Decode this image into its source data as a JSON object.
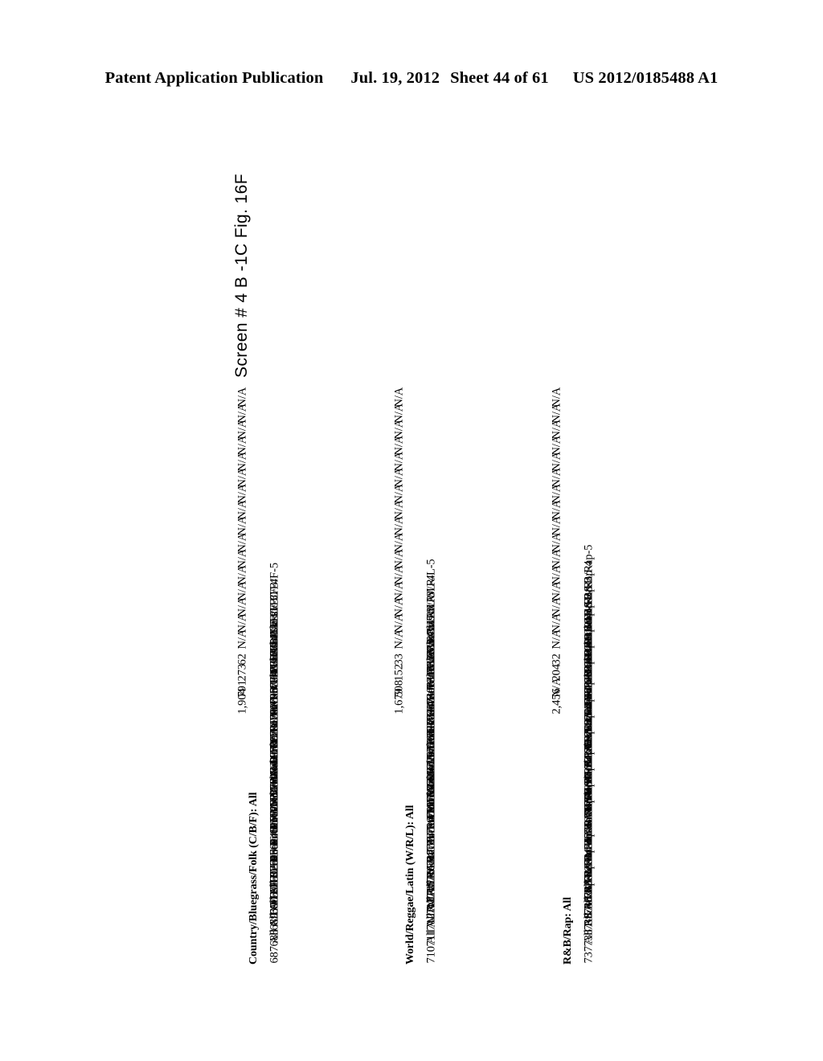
{
  "header": {
    "publication": "Patent Application Publication",
    "date": "Jul. 19, 2012",
    "sheet": "Sheet 44 of 61",
    "patent_number": "US 2012/0185488 A1"
  },
  "figure": {
    "caption": "Screen # 4 B -1C  Fig. 16F"
  },
  "table": {
    "columns": [
      {
        "header": "Country/Bluegrass/Folk (C/B/F): All",
        "rows": [
          {
            "id": "687",
            "label": "All C/B/F-2",
            "value": "1,904"
          },
          {
            "id": "688",
            "label": "All C/B/F-3",
            "value": "791"
          },
          {
            "id": "689",
            "label": "All C/B/F-4",
            "value": "273"
          },
          {
            "id": "690",
            "label": "All C/B/F-5",
            "value": "62"
          },
          {
            "id": "691",
            "label": "Recent C/B/F-2",
            "value": "N/A"
          },
          {
            "id": "692",
            "label": "Recent C/B/F-3",
            "value": "N/A"
          },
          {
            "id": "693",
            "label": "Recent C/B/F-4",
            "value": "N/A"
          },
          {
            "id": "694",
            "label": "Recent C/B/F-5",
            "value": "N/A"
          },
          {
            "id": "695",
            "label": "Modern C/B/F-2",
            "value": "N/A"
          },
          {
            "id": "696",
            "label": "Modern C/B/F-3",
            "value": "N/A"
          },
          {
            "id": "697",
            "label": "Modern C/B/F-4",
            "value": "N/A"
          },
          {
            "id": "698",
            "label": "Modern C/B/F-5",
            "value": "N/A"
          },
          {
            "id": "699",
            "label": "Recent + C/B/F-2",
            "value": "N/A"
          },
          {
            "id": "700",
            "label": "Recent + C/B/F-3",
            "value": "N/A"
          },
          {
            "id": "701",
            "label": "Recent + C/B/F-4",
            "value": "N/A"
          },
          {
            "id": "702",
            "label": "Recent + C/B/F-5",
            "value": "N/A"
          },
          {
            "id": "703",
            "label": "Classic C/B/F-2",
            "value": "N/A"
          },
          {
            "id": "704",
            "label": "Classic C/B/F-3",
            "value": "N/A"
          },
          {
            "id": "705",
            "label": "Classic C/B/F-4",
            "value": "N/A"
          },
          {
            "id": "706",
            "label": "Classic C/B/F-5",
            "value": "N/A"
          }
        ]
      },
      {
        "header": "World/Reggae/Latin (W/R/L): All",
        "rows": [
          {
            "id": "710",
            "label": "All W/R/L-2",
            "value": "1,679"
          },
          {
            "id": "711",
            "label": "All W/R/L-3",
            "value": "508"
          },
          {
            "id": "712",
            "label": "All W/R/L-4",
            "value": "152"
          },
          {
            "id": "713",
            "label": "All W/R/L-5",
            "value": "33"
          },
          {
            "id": "715",
            "label": "Recent W/R/L-2",
            "value": "N/A"
          },
          {
            "id": "716",
            "label": "Recent W/R/L-3",
            "value": "N/A"
          },
          {
            "id": "717",
            "label": "Recent W/R/L-4",
            "value": "N/A"
          },
          {
            "id": "718",
            "label": "Recent W/R/L-5",
            "value": "N/A"
          },
          {
            "id": "720",
            "label": "Modern W/R/L-2",
            "value": "N/A"
          },
          {
            "id": "721",
            "label": "Modern W/R/L-3",
            "value": "N/A"
          },
          {
            "id": "722",
            "label": "Modern W/R/L-4",
            "value": "N/A"
          },
          {
            "id": "723",
            "label": "Modern W/R/L-5",
            "value": "N/A"
          },
          {
            "id": "725",
            "label": "Recent + W/R/L-2",
            "value": "N/A"
          },
          {
            "id": "726",
            "label": "Recent + W/R/L-3",
            "value": "N/A"
          },
          {
            "id": "727",
            "label": "Recent + W/R/L-4",
            "value": "N/A"
          },
          {
            "id": "728",
            "label": "Recent + W/R/L-5",
            "value": "N/A"
          },
          {
            "id": "730",
            "label": "Classic W/R/L-2",
            "value": "N/A"
          },
          {
            "id": "731",
            "label": "Classic W/R/L-3",
            "value": "N/A"
          },
          {
            "id": "732",
            "label": "Classic W/R/L-4",
            "value": "N/A"
          },
          {
            "id": "733",
            "label": "Classic W/R/L-5",
            "value": "N/A"
          }
        ]
      },
      {
        "header": "R&B/Rap: All",
        "rows": [
          {
            "id": "737",
            "label": "All R&B/Rap-2",
            "value": "2,456"
          },
          {
            "id": "738",
            "label": "All R&B/Rap-3",
            "value": "N/A"
          },
          {
            "id": "739",
            "label": "All R&B/Rap-4",
            "value": "204"
          },
          {
            "id": "740",
            "label": "All R&B/Rap-5",
            "value": "32"
          },
          {
            "id": "742",
            "label": "Recent R&B/Rap-2",
            "value": "N/A"
          },
          {
            "id": "743",
            "label": "Recent R&B/Rap-3",
            "value": "N/A"
          },
          {
            "id": "744",
            "label": "Recent R&B/Rap-4",
            "value": "N/A"
          },
          {
            "id": "745",
            "label": "Recent R&B/Rap-5",
            "value": "N/A"
          },
          {
            "id": "746",
            "label": "Modern R&B/Rap-2",
            "value": "N/A"
          },
          {
            "id": "747",
            "label": "Modern R&B/Rap-3",
            "value": "N/A"
          },
          {
            "id": "748",
            "label": "Modern R&B/Rap-4",
            "value": "N/A"
          },
          {
            "id": "749",
            "label": "Modern R&B/Rap-5",
            "value": "N/A"
          },
          {
            "id": "751",
            "label": "Recent + R&B/Rap-2",
            "value": "N/A"
          },
          {
            "id": "752",
            "label": "Recent + R&B/Rap-3",
            "value": "N/A"
          },
          {
            "id": "753",
            "label": "Recent + R&B/Rap-4",
            "value": "N/A"
          },
          {
            "id": "754",
            "label": "Recent + R&B/Rap-5",
            "value": "N/A"
          },
          {
            "id": "757",
            "label": "Classic R&B/Rap-2",
            "value": "N/A"
          },
          {
            "id": "758",
            "label": "Classic R&B/Rap-3",
            "value": "N/A"
          },
          {
            "id": "759",
            "label": "Classic R&B/Rap-4",
            "value": "N/A"
          },
          {
            "id": "760",
            "label": "Classic R&B/Rap-5",
            "value": "N/A"
          }
        ]
      }
    ]
  }
}
